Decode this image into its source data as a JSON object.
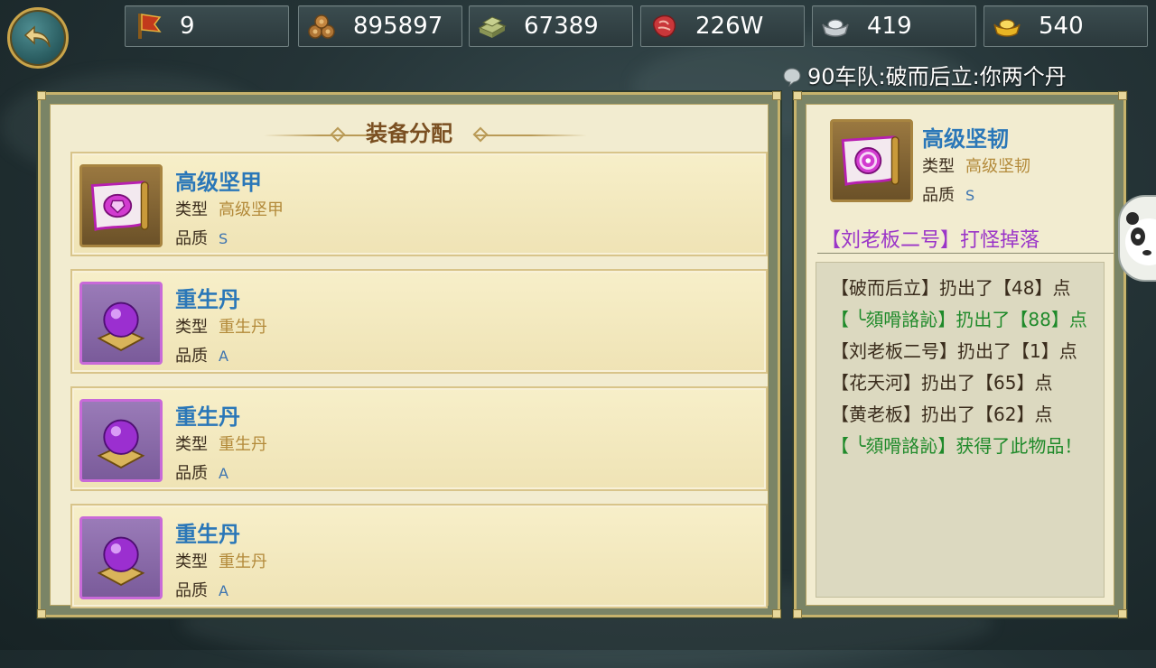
{
  "colors": {
    "accent_blue": "#2a77b8",
    "gold_text": "#b38a3a",
    "purple_drop": "#9b35c8",
    "green_log": "#1f8a2a",
    "panel_bg": "#f2ecd0"
  },
  "resources": [
    {
      "icon": "flag-banner-icon",
      "value": "9"
    },
    {
      "icon": "wood-logs-icon",
      "value": "895897"
    },
    {
      "icon": "stone-slab-icon",
      "value": "67389"
    },
    {
      "icon": "meat-icon",
      "value": "226W"
    },
    {
      "icon": "silver-ingot-icon",
      "value": "419"
    },
    {
      "icon": "gold-ingot-icon",
      "value": "540"
    }
  ],
  "chat": {
    "icon": "chat-bubble-icon",
    "text": "90车队:破而后立:你两个丹"
  },
  "left_panel": {
    "title": "装备分配",
    "items": [
      {
        "name": "高级坚甲",
        "type_label": "类型",
        "type_value": "高级坚甲",
        "quality_label": "品质",
        "quality_value": "S",
        "icon": "scroll-icon"
      },
      {
        "name": "重生丹",
        "type_label": "类型",
        "type_value": "重生丹",
        "quality_label": "品质",
        "quality_value": "A",
        "icon": "purple-orb-icon"
      },
      {
        "name": "重生丹",
        "type_label": "类型",
        "type_value": "重生丹",
        "quality_label": "品质",
        "quality_value": "A",
        "icon": "purple-orb-icon"
      },
      {
        "name": "重生丹",
        "type_label": "类型",
        "type_value": "重生丹",
        "quality_label": "品质",
        "quality_value": "A",
        "icon": "purple-orb-icon"
      }
    ]
  },
  "right_panel": {
    "name": "高级坚韧",
    "type_label": "类型",
    "type_value": "高级坚韧",
    "quality_label": "品质",
    "quality_value": "S",
    "drop_source": "【刘老板二号】打怪掉落",
    "log": [
      {
        "text": "【破而后立】扔出了【48】点",
        "green": false
      },
      {
        "text": "【 ╰頦嗗詻�french】扔出了【88】点",
        "green": true
      },
      {
        "text": "【刘老板二号】扔出了【1】点",
        "green": false
      },
      {
        "text": "【花天河】扔出了【65】点",
        "green": false
      },
      {
        "text": "【黄老板】扔出了【62】点",
        "green": false
      },
      {
        "text": "【 ╰頦嗗詻訫】获得了此物品！",
        "green": true
      }
    ]
  }
}
